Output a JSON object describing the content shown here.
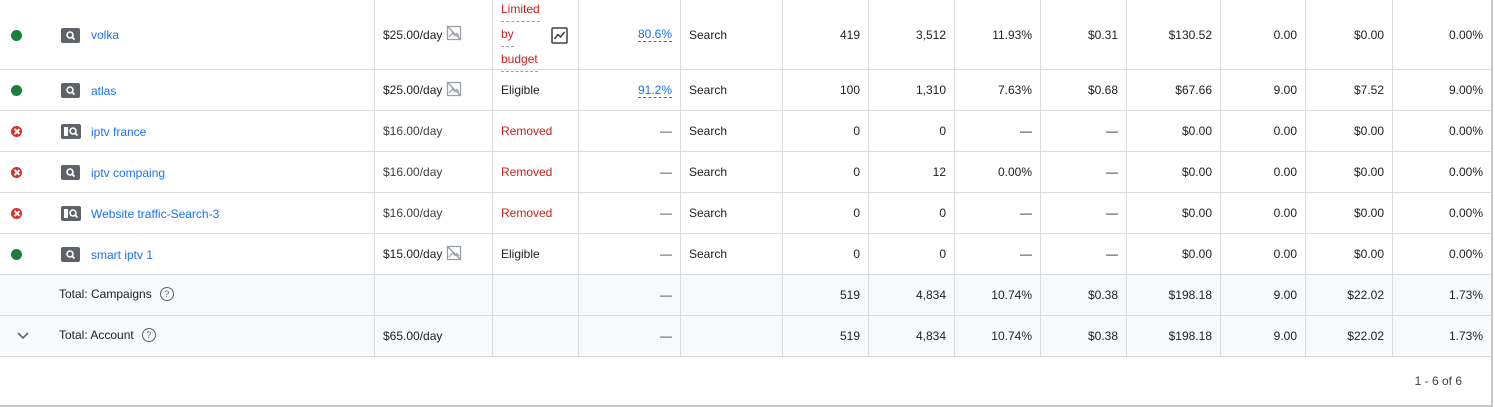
{
  "campaigns": [
    {
      "name": "volka",
      "status": "enabled",
      "type_icon": "search-icon",
      "budget": "$25.00/day",
      "budget_flag": true,
      "status_lines": [
        "Limited",
        "by",
        "budget"
      ],
      "status_style": "limited",
      "opt_score": "80.6%",
      "type": "Search",
      "clicks": "419",
      "impr": "3,512",
      "ctr": "11.93%",
      "avg_cpc": "$0.31",
      "cost": "$130.52",
      "conversions": "0.00",
      "cost_conv": "$0.00",
      "conv_rate": "0.00%"
    },
    {
      "name": "atlas",
      "status": "enabled",
      "type_icon": "search-icon",
      "budget": "$25.00/day",
      "budget_flag": true,
      "status_text": "Eligible",
      "status_style": "eligible",
      "opt_score": "91.2%",
      "type": "Search",
      "clicks": "100",
      "impr": "1,310",
      "ctr": "7.63%",
      "avg_cpc": "$0.68",
      "cost": "$67.66",
      "conversions": "9.00",
      "cost_conv": "$7.52",
      "conv_rate": "9.00%"
    },
    {
      "name": "iptv france",
      "status": "removed",
      "type_icon": "search-page-icon",
      "budget": "$16.00/day",
      "budget_flag": false,
      "status_text": "Removed",
      "status_style": "removed",
      "opt_score": "—",
      "type": "Search",
      "clicks": "0",
      "impr": "0",
      "ctr": "—",
      "avg_cpc": "—",
      "cost": "$0.00",
      "conversions": "0.00",
      "cost_conv": "$0.00",
      "conv_rate": "0.00%"
    },
    {
      "name": "iptv compaing",
      "status": "removed",
      "type_icon": "search-icon",
      "budget": "$16.00/day",
      "budget_flag": false,
      "status_text": "Removed",
      "status_style": "removed",
      "opt_score": "—",
      "type": "Search",
      "clicks": "0",
      "impr": "12",
      "ctr": "0.00%",
      "avg_cpc": "—",
      "cost": "$0.00",
      "conversions": "0.00",
      "cost_conv": "$0.00",
      "conv_rate": "0.00%"
    },
    {
      "name": "Website traffic-Search-3",
      "status": "removed",
      "type_icon": "search-page-icon",
      "budget": "$16.00/day",
      "budget_flag": false,
      "status_text": "Removed",
      "status_style": "removed",
      "opt_score": "—",
      "type": "Search",
      "clicks": "0",
      "impr": "0",
      "ctr": "—",
      "avg_cpc": "—",
      "cost": "$0.00",
      "conversions": "0.00",
      "cost_conv": "$0.00",
      "conv_rate": "0.00%"
    },
    {
      "name": "smart iptv 1",
      "status": "enabled",
      "type_icon": "search-icon",
      "budget": "$15.00/day",
      "budget_flag": true,
      "status_text": "Eligible",
      "status_style": "eligible",
      "opt_score": "—",
      "type": "Search",
      "clicks": "0",
      "impr": "0",
      "ctr": "—",
      "avg_cpc": "—",
      "cost": "$0.00",
      "conversions": "0.00",
      "cost_conv": "$0.00",
      "conv_rate": "0.00%"
    }
  ],
  "totals": [
    {
      "label": "Total: Campaigns",
      "budget": "",
      "opt_score": "—",
      "clicks": "519",
      "impr": "4,834",
      "ctr": "10.74%",
      "avg_cpc": "$0.38",
      "cost": "$198.18",
      "conversions": "9.00",
      "cost_conv": "$22.02",
      "conv_rate": "1.73%",
      "expand": false
    },
    {
      "label": "Total: Account",
      "budget": "$65.00/day",
      "opt_score": "—",
      "clicks": "519",
      "impr": "4,834",
      "ctr": "10.74%",
      "avg_cpc": "$0.38",
      "cost": "$198.18",
      "conversions": "9.00",
      "cost_conv": "$22.02",
      "conv_rate": "1.73%",
      "expand": true
    }
  ],
  "pagination": "1 - 6 of 6",
  "colors": {
    "link": "#1a73e8",
    "enabled": "#188038",
    "removed": "#d93025",
    "removed_text": "#c5221f"
  }
}
